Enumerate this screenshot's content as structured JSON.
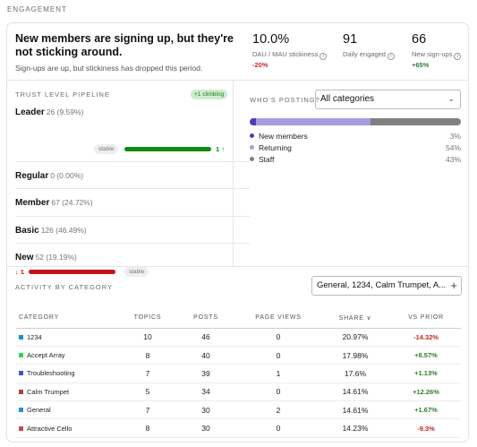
{
  "section_label": "ENGAGEMENT",
  "header": {
    "headline": "New members are signing up, but they're not sticking around.",
    "subline": "Sign-ups are up, but stickiness has dropped this period.",
    "metrics": [
      {
        "value": "10.0%",
        "label": "DAU / MAU stickiness",
        "delta": "-20%",
        "info_icon": "info-icon"
      },
      {
        "value": "91",
        "label": "Daily engaged",
        "delta": "",
        "info_icon": "info-icon"
      },
      {
        "value": "66",
        "label": "New sign-ups",
        "delta": "+65%",
        "info_icon": "info-icon"
      }
    ]
  },
  "trust": {
    "title": "TRUST LEVEL PIPELINE",
    "badge": "+1 climbing",
    "levels": [
      {
        "name": "Leader",
        "count": "26 (9.59%)",
        "tag": "stable",
        "trend": "1 ↑",
        "trend_color": "#138a13"
      },
      {
        "name": "Regular",
        "count": "0 (0.00%)"
      },
      {
        "name": "Member",
        "count": "67 (24.72%)"
      },
      {
        "name": "Basic",
        "count": "126 (46.49%)"
      },
      {
        "name": "New",
        "count": "52 (19.19%)",
        "tag": "stable",
        "trend": "↓ 1",
        "trend_color": "#c0171b"
      }
    ]
  },
  "who": {
    "title": "WHO'S POSTING?",
    "select_value": "All categories",
    "segments": [
      {
        "name": "New members",
        "pct": "3%",
        "value": 3,
        "color": "#4b3fb5"
      },
      {
        "name": "Returning",
        "pct": "54%",
        "value": 54,
        "color": "#a99bdf"
      },
      {
        "name": "Staff",
        "pct": "43%",
        "value": 43,
        "color": "#808080"
      }
    ]
  },
  "activity": {
    "title": "ACTIVITY BY CATEGORY",
    "filter_value": "General, 1234, Calm Trumpet, A...",
    "plus": "+",
    "columns": [
      "CATEGORY",
      "TOPICS",
      "POSTS",
      "PAGE VIEWS",
      "SHARE ∨",
      "VS PRIOR"
    ],
    "rows": [
      {
        "name": "1234",
        "color": "#1d8fbd",
        "topics": "10",
        "posts": "46",
        "views": "0",
        "share": "20.97%",
        "vs": "-14.32%",
        "vs_sign": "neg"
      },
      {
        "name": "Accept Array",
        "color": "#2fd45a",
        "topics": "8",
        "posts": "40",
        "views": "0",
        "share": "17.98%",
        "vs": "+8.57%",
        "vs_sign": "pos"
      },
      {
        "name": "Troubleshooting",
        "color": "#3f58b8",
        "topics": "7",
        "posts": "39",
        "views": "1",
        "share": "17.6%",
        "vs": "+1.13%",
        "vs_sign": "pos"
      },
      {
        "name": "Calm Trumpet",
        "color": "#b24334",
        "topics": "5",
        "posts": "34",
        "views": "0",
        "share": "14.61%",
        "vs": "+12.26%",
        "vs_sign": "pos"
      },
      {
        "name": "General",
        "color": "#2490d8",
        "topics": "7",
        "posts": "30",
        "views": "2",
        "share": "14.61%",
        "vs": "+1.67%",
        "vs_sign": "pos"
      },
      {
        "name": "Attractive Cello",
        "color": "#c34a5a",
        "topics": "8",
        "posts": "30",
        "views": "0",
        "share": "14.23%",
        "vs": "-9.3%",
        "vs_sign": "neg"
      }
    ]
  }
}
